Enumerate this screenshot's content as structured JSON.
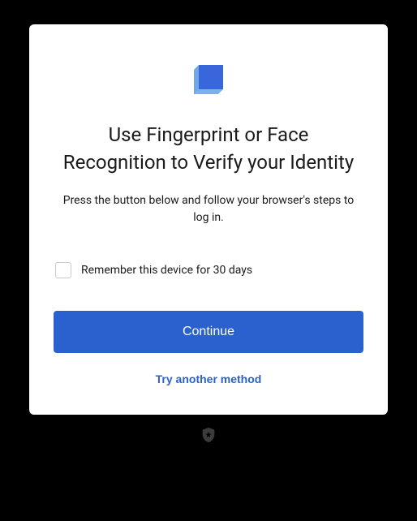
{
  "title": "Use Fingerprint or Face Recognition to Verify your Identity",
  "subtitle": "Press the button below and follow your browser's steps to log in.",
  "remember": {
    "label": "Remember this device for 30 days",
    "checked": false
  },
  "actions": {
    "primary": "Continue",
    "secondary": "Try another method"
  },
  "colors": {
    "accent": "#2A61CF"
  }
}
